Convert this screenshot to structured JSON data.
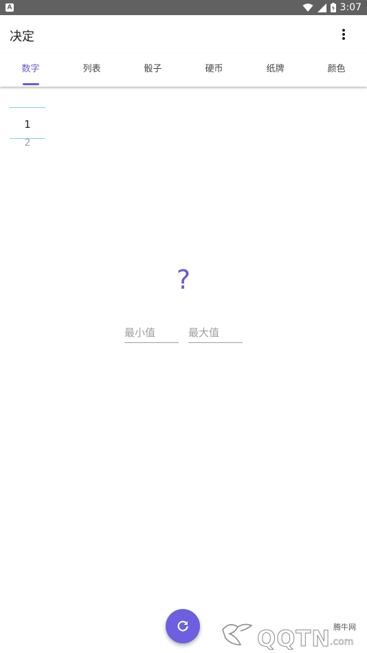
{
  "status_bar": {
    "app_badge": "A",
    "time": "3:07"
  },
  "app_bar": {
    "title": "决定"
  },
  "tabs": [
    {
      "label": "数字",
      "active": true
    },
    {
      "label": "列表",
      "active": false
    },
    {
      "label": "骰子",
      "active": false
    },
    {
      "label": "硬币",
      "active": false
    },
    {
      "label": "纸牌",
      "active": false
    },
    {
      "label": "颜色",
      "active": false
    }
  ],
  "picker": {
    "selected": "1",
    "next": "2"
  },
  "result": {
    "text": "?"
  },
  "inputs": {
    "min_placeholder": "最小值",
    "max_placeholder": "最大值"
  },
  "watermark": {
    "small_text": "腾牛网",
    "logo": "QQTN",
    "suffix": ".com"
  },
  "colors": {
    "accent": "#6a5acd",
    "fab": "#6d5fe0",
    "status_bar": "#616161",
    "picker_line": "#80d0e0"
  },
  "icons": {
    "overflow": "more-vert-icon",
    "refresh": "refresh-icon",
    "wifi": "wifi-icon",
    "signal": "signal-icon",
    "battery": "battery-icon"
  }
}
